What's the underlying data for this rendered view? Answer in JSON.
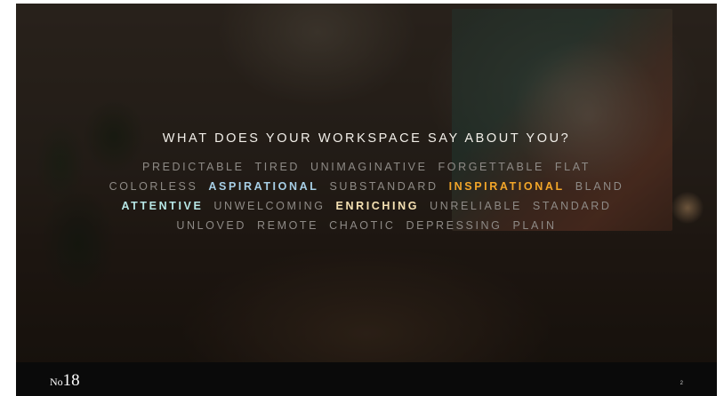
{
  "slide": {
    "headline": "WHAT DOES YOUR WORKSPACE SAY ABOUT YOU?",
    "lines": [
      [
        {
          "text": "PREDICTABLE",
          "style": "muted"
        },
        {
          "text": "TIRED",
          "style": "muted"
        },
        {
          "text": "UNIMAGINATIVE",
          "style": "muted"
        },
        {
          "text": "FORGETTABLE",
          "style": "muted"
        },
        {
          "text": "FLAT",
          "style": "muted"
        }
      ],
      [
        {
          "text": "COLORLESS",
          "style": "muted"
        },
        {
          "text": "ASPIRATIONAL",
          "style": "blue"
        },
        {
          "text": "SUBSTANDARD",
          "style": "muted"
        },
        {
          "text": "INSPIRATIONAL",
          "style": "orange"
        },
        {
          "text": "BLAND",
          "style": "muted"
        }
      ],
      [
        {
          "text": "ATTENTIVE",
          "style": "teal"
        },
        {
          "text": "UNWELCOMING",
          "style": "muted"
        },
        {
          "text": "ENRICHING",
          "style": "cream"
        },
        {
          "text": "UNRELIABLE",
          "style": "muted"
        },
        {
          "text": "STANDARD",
          "style": "muted"
        }
      ],
      [
        {
          "text": "UNLOVED",
          "style": "muted"
        },
        {
          "text": "REMOTE",
          "style": "muted"
        },
        {
          "text": "CHAOTIC",
          "style": "muted"
        },
        {
          "text": "DEPRESSING",
          "style": "muted"
        },
        {
          "text": "PLAIN",
          "style": "muted"
        }
      ]
    ]
  },
  "footer": {
    "logo_prefix": "No",
    "logo_number": "18",
    "page_number": "2"
  },
  "colors": {
    "muted": "#8e8a86",
    "blue": "#a7cfe6",
    "orange": "#f2a629",
    "teal": "#b7e7e6",
    "cream": "#f6e1b3",
    "footer_bg": "#0a0a0a"
  }
}
